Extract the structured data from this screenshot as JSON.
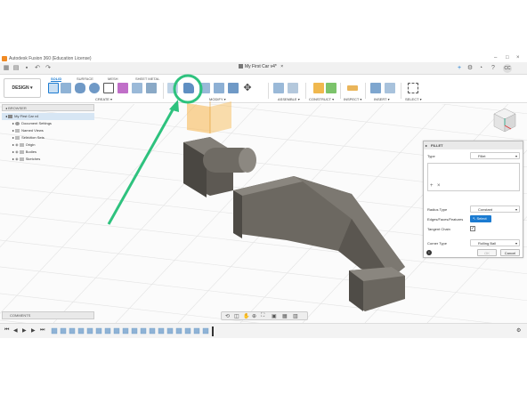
{
  "window": {
    "title": "Autodesk Fusion 360 (Education License)"
  },
  "document_tab": {
    "name": "My First Car v4*"
  },
  "user": {
    "initials": "CC"
  },
  "ribbon": {
    "design_label": "DESIGN",
    "tabs": [
      "SOLID",
      "SURFACE",
      "MESH",
      "SHEET METAL"
    ],
    "active_tab": "SOLID",
    "groups": [
      "CREATE",
      "MODIFY",
      "ASSEMBLE",
      "CONSTRUCT",
      "INSPECT",
      "INSERT",
      "SELECT"
    ],
    "highlight_color": "#2ec27e"
  },
  "browser": {
    "title": "BROWSER",
    "root": "My First Car v4",
    "items": [
      "Document Settings",
      "Named Views",
      "Selection Sets",
      "Origin",
      "Bodies",
      "Sketches"
    ]
  },
  "fillet_panel": {
    "title": "FILLET",
    "type_label": "Type",
    "type_value": "Fillet",
    "radius_type_label": "Radius Type",
    "radius_type_value": "Constant",
    "edges_label": "Edges/Faces/Features",
    "select_label": "Select",
    "tangent_chain_label": "Tangent Chain",
    "tangent_chain_checked": true,
    "corner_type_label": "Corner Type",
    "corner_type_value": "Rolling Ball",
    "ok_label": "OK",
    "cancel_label": "Cancel"
  },
  "comments": {
    "label": "COMMENTS"
  },
  "colors": {
    "accent": "#1b7bd1",
    "model": "#5e5a54",
    "highlight_arrow": "#2ec27e",
    "sketch_plane": "#f7b54a"
  }
}
